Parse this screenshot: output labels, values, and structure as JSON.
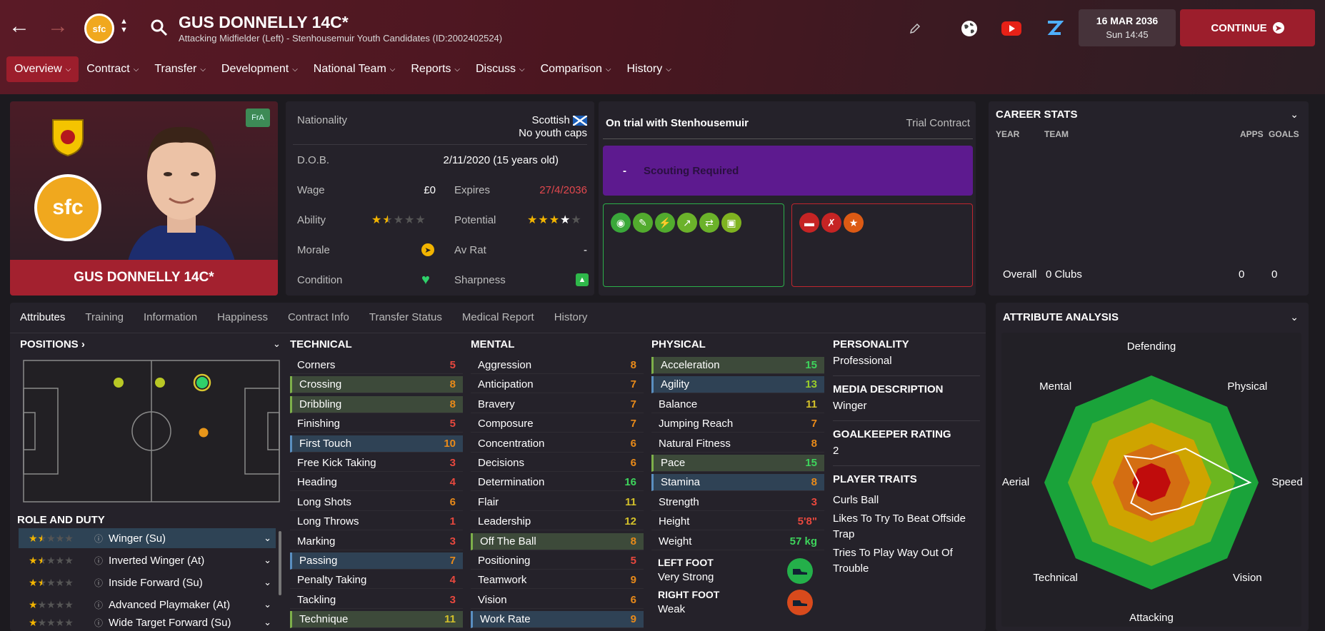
{
  "header": {
    "title": "GUS DONNELLY 14C*",
    "subtitle": "Attacking Midfielder (Left) - Stenhousemuir Youth Candidates (ID:2002402524)",
    "club_badge_text": "sfc",
    "date": "16 MAR 2036",
    "time": "Sun 14:45",
    "continue_label": "CONTINUE"
  },
  "tabs": [
    {
      "label": "Overview"
    },
    {
      "label": "Contract"
    },
    {
      "label": "Transfer"
    },
    {
      "label": "Development"
    },
    {
      "label": "National Team"
    },
    {
      "label": "Reports"
    },
    {
      "label": "Discuss"
    },
    {
      "label": "Comparison"
    },
    {
      "label": "History"
    }
  ],
  "profile": {
    "name": "GUS DONNELLY 14C*",
    "fra_badge": "FrA",
    "club_badge_text": "sfc"
  },
  "info": {
    "nationality_label": "Nationality",
    "nationality_value": "Scottish",
    "youth_caps": "No youth caps",
    "dob_label": "D.O.B.",
    "dob_value": "2/11/2020 (15 years old)",
    "wage_label": "Wage",
    "wage_value": "£0",
    "expires_label": "Expires",
    "expires_value": "27/4/2036",
    "ability_label": "Ability",
    "ability_stars": 1.5,
    "potential_label": "Potential",
    "potential_stars": 3.5,
    "morale_label": "Morale",
    "avrat_label": "Av Rat",
    "avrat_value": "-",
    "condition_label": "Condition",
    "sharpness_label": "Sharpness"
  },
  "trial": {
    "title": "On trial with Stenhousemuir",
    "contract": "Trial Contract",
    "scouting_dash": "-",
    "scouting_label": "Scouting Required",
    "positive_icons": [
      "brain-icon",
      "boot-icon",
      "boot-icon",
      "trend-icon",
      "arrows-icon",
      "pitch-icon"
    ],
    "negative_icons": [
      "dumbbell-icon",
      "injury-icon",
      "star-icon"
    ]
  },
  "career": {
    "title": "CAREER STATS",
    "col_year": "YEAR",
    "col_team": "TEAM",
    "col_apps": "APPS",
    "col_goals": "GOALS",
    "overall_label": "Overall",
    "overall_clubs": "0 Clubs",
    "overall_apps": "0",
    "overall_goals": "0"
  },
  "subtabs": [
    {
      "label": "Attributes"
    },
    {
      "label": "Training"
    },
    {
      "label": "Information"
    },
    {
      "label": "Happiness"
    },
    {
      "label": "Contract Info"
    },
    {
      "label": "Transfer Status"
    },
    {
      "label": "Medical Report"
    },
    {
      "label": "History"
    }
  ],
  "positions": {
    "title": "POSITIONS",
    "role_title": "ROLE AND DUTY",
    "roles": [
      {
        "label": "Winger (Su)",
        "stars": 1.5
      },
      {
        "label": "Inverted Winger (At)",
        "stars": 1.5
      },
      {
        "label": "Inside Forward (Su)",
        "stars": 1.5
      },
      {
        "label": "Advanced Playmaker (At)",
        "stars": 1
      },
      {
        "label": "Wide Target Forward (Su)",
        "stars": 1
      }
    ]
  },
  "technical": {
    "title": "TECHNICAL",
    "rows": [
      {
        "label": "Corners",
        "value": "5"
      },
      {
        "label": "Crossing",
        "value": "8"
      },
      {
        "label": "Dribbling",
        "value": "8"
      },
      {
        "label": "Finishing",
        "value": "5"
      },
      {
        "label": "First Touch",
        "value": "10"
      },
      {
        "label": "Free Kick Taking",
        "value": "3"
      },
      {
        "label": "Heading",
        "value": "4"
      },
      {
        "label": "Long Shots",
        "value": "6"
      },
      {
        "label": "Long Throws",
        "value": "1"
      },
      {
        "label": "Marking",
        "value": "3"
      },
      {
        "label": "Passing",
        "value": "7"
      },
      {
        "label": "Penalty Taking",
        "value": "4"
      },
      {
        "label": "Tackling",
        "value": "3"
      },
      {
        "label": "Technique",
        "value": "11"
      }
    ]
  },
  "mental": {
    "title": "MENTAL",
    "rows": [
      {
        "label": "Aggression",
        "value": "8"
      },
      {
        "label": "Anticipation",
        "value": "7"
      },
      {
        "label": "Bravery",
        "value": "7"
      },
      {
        "label": "Composure",
        "value": "7"
      },
      {
        "label": "Concentration",
        "value": "6"
      },
      {
        "label": "Decisions",
        "value": "6"
      },
      {
        "label": "Determination",
        "value": "16"
      },
      {
        "label": "Flair",
        "value": "11"
      },
      {
        "label": "Leadership",
        "value": "12"
      },
      {
        "label": "Off The Ball",
        "value": "8"
      },
      {
        "label": "Positioning",
        "value": "5"
      },
      {
        "label": "Teamwork",
        "value": "9"
      },
      {
        "label": "Vision",
        "value": "6"
      },
      {
        "label": "Work Rate",
        "value": "9"
      }
    ]
  },
  "physical": {
    "title": "PHYSICAL",
    "rows": [
      {
        "label": "Acceleration",
        "value": "15"
      },
      {
        "label": "Agility",
        "value": "13"
      },
      {
        "label": "Balance",
        "value": "11"
      },
      {
        "label": "Jumping Reach",
        "value": "7"
      },
      {
        "label": "Natural Fitness",
        "value": "8"
      },
      {
        "label": "Pace",
        "value": "15"
      },
      {
        "label": "Stamina",
        "value": "8"
      },
      {
        "label": "Strength",
        "value": "3"
      },
      {
        "label": "Height",
        "value": "5'8\""
      },
      {
        "label": "Weight",
        "value": "57 kg"
      }
    ],
    "left_foot_label": "LEFT FOOT",
    "left_foot_value": "Very Strong",
    "right_foot_label": "RIGHT FOOT",
    "right_foot_value": "Weak"
  },
  "personality": {
    "personality_title": "PERSONALITY",
    "personality_value": "Professional",
    "media_title": "MEDIA DESCRIPTION",
    "media_value": "Winger",
    "gk_title": "GOALKEEPER RATING",
    "gk_value": "2",
    "traits_title": "PLAYER TRAITS",
    "traits": [
      "Curls Ball",
      "Likes To Try To Beat Offside Trap",
      "Tries To Play Way Out Of Trouble"
    ]
  },
  "analysis": {
    "title": "ATTRIBUTE ANALYSIS",
    "labels": [
      "Defending",
      "Physical",
      "Speed",
      "Vision",
      "Attacking",
      "Technical",
      "Aerial",
      "Mental"
    ],
    "values": [
      0.22,
      0.45,
      0.92,
      0.35,
      0.3,
      0.27,
      0.12,
      0.35
    ],
    "colors": {
      "ring1": "#1aa33a",
      "ring2": "#6cb61f",
      "ring3": "#cfa400",
      "ring4": "#d46e12",
      "core": "#c00c0c"
    }
  }
}
